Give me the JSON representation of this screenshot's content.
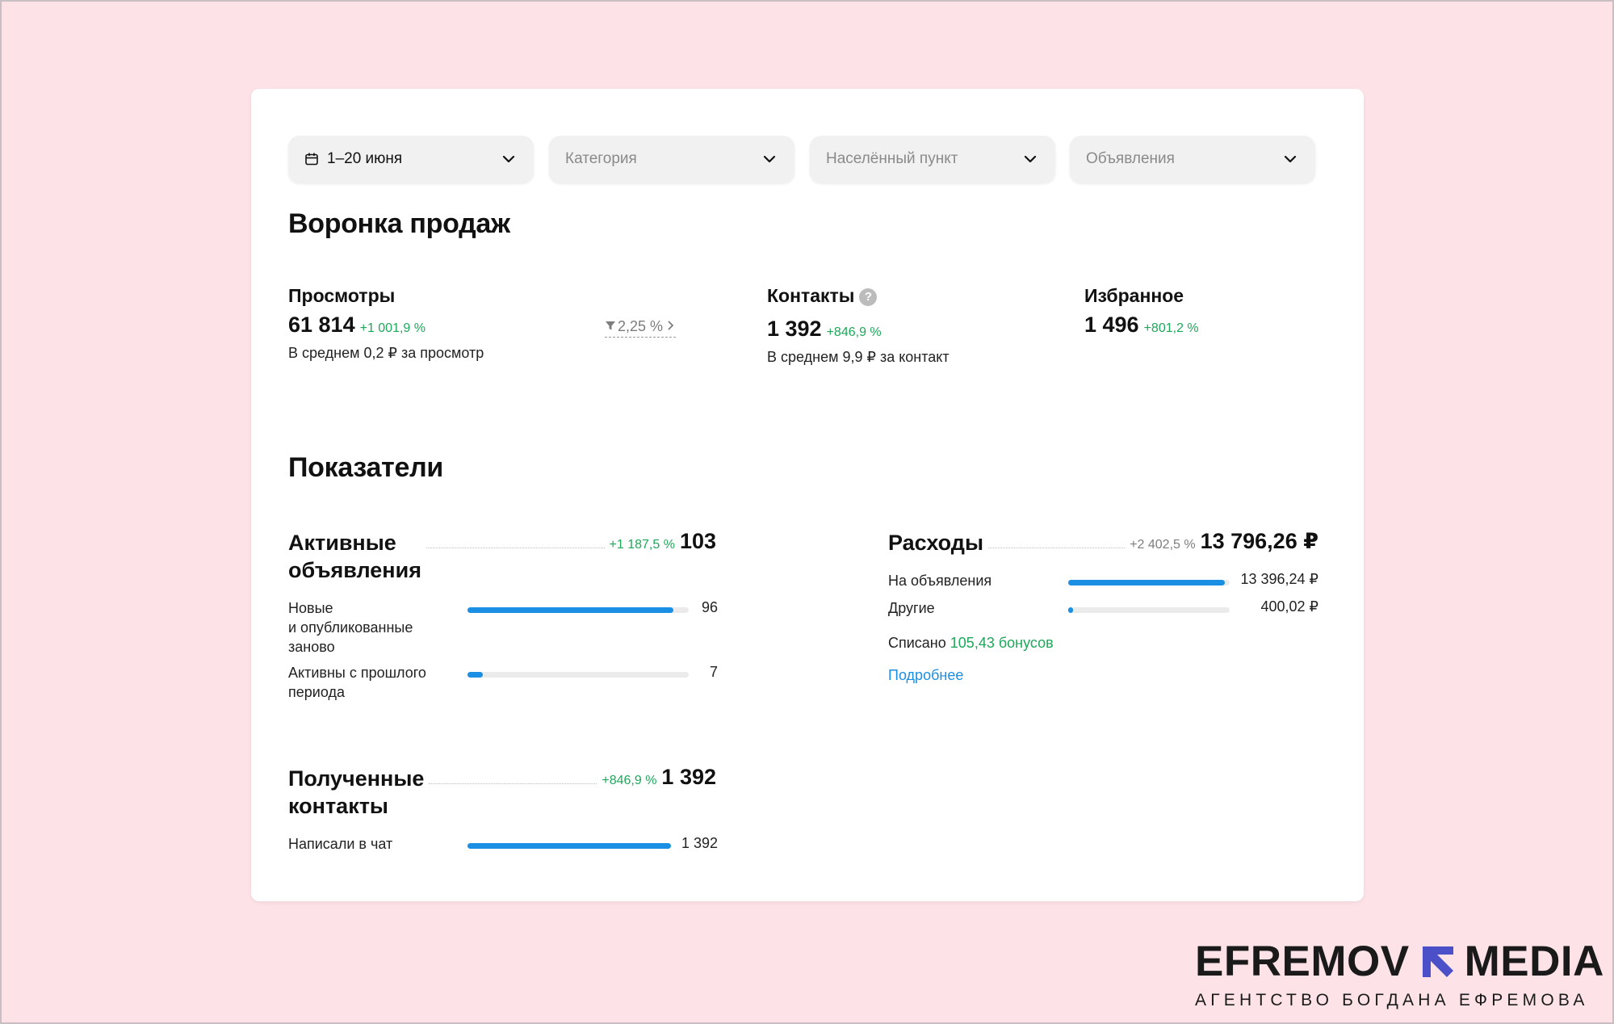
{
  "filters": [
    {
      "label": "1–20 июня",
      "icon": "calendar-icon"
    },
    {
      "label": "Категория"
    },
    {
      "label": "Населённый пункт"
    },
    {
      "label": "Объявления"
    }
  ],
  "funnel": {
    "title": "Воронка продаж",
    "views": {
      "title": "Просмотры",
      "value": "61 814",
      "delta": "+1 001,9 %",
      "sub": "В среднем 0,2 ₽ за просмотр",
      "conversion": "2,25 %"
    },
    "contacts": {
      "title": "Контакты",
      "value": "1 392",
      "delta": "+846,9 %",
      "sub": "В среднем 9,9 ₽ за контакт",
      "help": "?"
    },
    "favorites": {
      "title": "Избранное",
      "value": "1 496",
      "delta": "+801,2 %"
    }
  },
  "indicators": {
    "title": "Показатели",
    "active": {
      "title_line1": "Активные",
      "title_line2": "объявления",
      "delta": "+1 187,5 %",
      "total": "103",
      "rows": [
        {
          "label_lines": [
            "Новые",
            "и опубликованные",
            "заново"
          ],
          "value": "96",
          "fraction": 0.932
        },
        {
          "label_lines": [
            "Активны с прошлого",
            "периода"
          ],
          "value": "7",
          "fraction": 0.068
        }
      ]
    },
    "expenses": {
      "title": "Расходы",
      "delta": "+2 402,5 %",
      "total": "13 796,26 ₽",
      "rows": [
        {
          "label": "На объявления",
          "value": "13 396,24 ₽",
          "fraction": 0.971
        },
        {
          "label": "Другие",
          "value": "400,02 ₽",
          "fraction": 0.029
        }
      ],
      "written_off_label": "Списано",
      "written_off_value": "105,43 бонусов",
      "more_link": "Подробнее"
    },
    "contacts": {
      "title_line1": "Полученные",
      "title_line2": "контакты",
      "delta": "+846,9 %",
      "total": "1 392",
      "rows": [
        {
          "label": "Написали в чат",
          "value": "1 392",
          "fraction": 1.0
        }
      ]
    }
  },
  "brand": {
    "name_left": "EFREMOV",
    "name_right": "MEDIA",
    "tagline": "АГЕНТСТВО БОГДАНА ЕФРЕМОВА",
    "accent_color": "#4b4fc8"
  },
  "colors": {
    "background": "#fde3e7",
    "bar": "#1a8fe3",
    "positive": "#1ea85a"
  }
}
